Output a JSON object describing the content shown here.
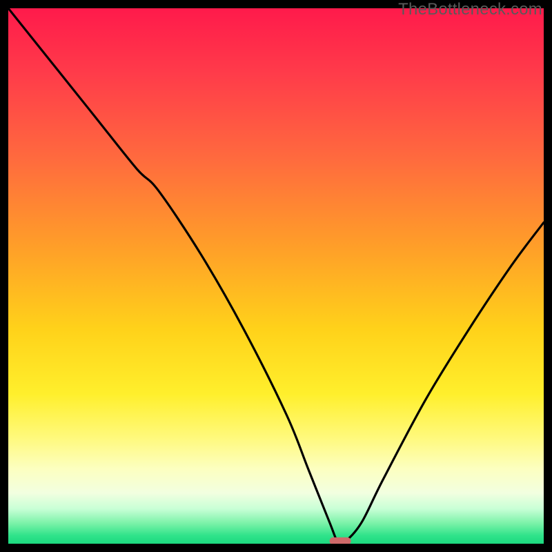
{
  "watermark": "TheBottleneck.com",
  "chart_data": {
    "type": "line",
    "title": "",
    "xlabel": "",
    "ylabel": "",
    "xlim": [
      0,
      100
    ],
    "ylim": [
      0,
      100
    ],
    "series": [
      {
        "name": "bottleneck-curve",
        "x": [
          0,
          8,
          16,
          24,
          28,
          36,
          44,
          52,
          56,
          60,
          61.5,
          63,
          66,
          70,
          78,
          86,
          94,
          100
        ],
        "y": [
          100,
          90,
          80,
          70,
          66,
          54,
          40,
          24,
          14,
          4,
          0.5,
          0.5,
          4,
          12,
          27,
          40,
          52,
          60
        ]
      }
    ],
    "marker": {
      "x": 62,
      "y": 0.5,
      "width": 4,
      "height": 1.4,
      "color": "#cf6a6a",
      "radius": 1.2
    },
    "gradient_stops": [
      {
        "offset": 0.0,
        "color": "#ff1a4b"
      },
      {
        "offset": 0.12,
        "color": "#ff3b4a"
      },
      {
        "offset": 0.28,
        "color": "#ff6a3e"
      },
      {
        "offset": 0.45,
        "color": "#ffa028"
      },
      {
        "offset": 0.6,
        "color": "#ffd21a"
      },
      {
        "offset": 0.72,
        "color": "#ffef2c"
      },
      {
        "offset": 0.8,
        "color": "#fff97a"
      },
      {
        "offset": 0.86,
        "color": "#fcffc0"
      },
      {
        "offset": 0.905,
        "color": "#f2ffe0"
      },
      {
        "offset": 0.935,
        "color": "#c8ffd6"
      },
      {
        "offset": 0.962,
        "color": "#7af2a8"
      },
      {
        "offset": 0.985,
        "color": "#2fe38a"
      },
      {
        "offset": 1.0,
        "color": "#1cd97f"
      }
    ]
  }
}
